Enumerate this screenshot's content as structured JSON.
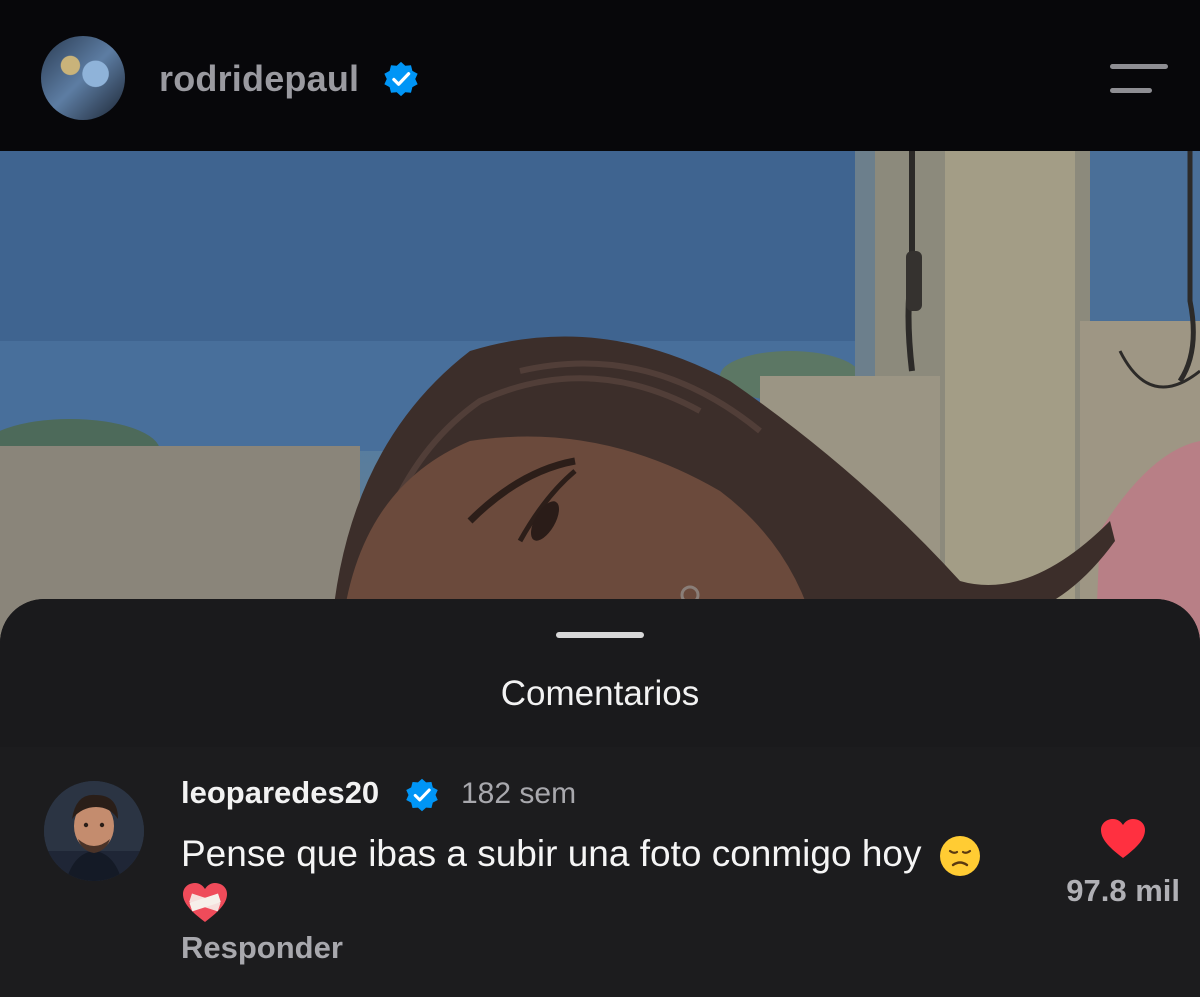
{
  "header": {
    "username": "rodridepaul",
    "verified": true,
    "icons": {
      "avatar": "profile-avatar",
      "menu": "hamburger-menu-icon",
      "badge": "verified-badge-icon"
    }
  },
  "post": {
    "image_description_icon": "post-photo"
  },
  "comments_sheet": {
    "title": "Comentarios",
    "comments": [
      {
        "username": "leoparedes20",
        "verified": true,
        "time": "182 sem",
        "text": "Pense que ibas a subir una foto conmigo hoy",
        "emojis": [
          "disappointed-face",
          "mending-heart"
        ],
        "reply_label": "Responder",
        "likes": "97.8 mil",
        "liked": true
      }
    ]
  },
  "colors": {
    "background": "#07070a",
    "sheet": "#1c1c1e",
    "verified_blue": "#0095f6",
    "like_red": "#ff3040",
    "muted_text": "#a8a8ad"
  }
}
